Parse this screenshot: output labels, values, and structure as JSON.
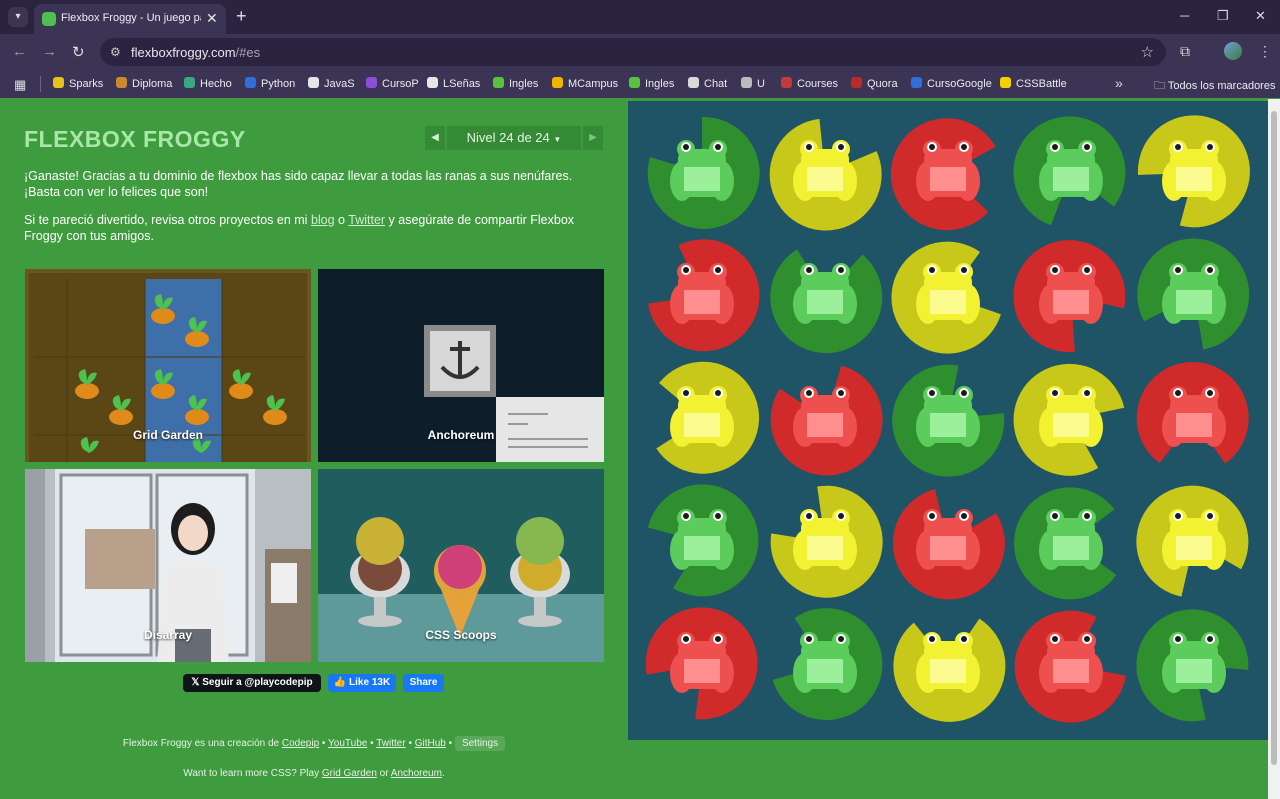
{
  "browser": {
    "tab_title": "Flexbox Froggy - Un juego para",
    "url_host": "flexboxfroggy.com",
    "url_path": "/#es",
    "bookmarks": [
      {
        "label": "Sparks",
        "color": "#e8c21a"
      },
      {
        "label": "Diploma",
        "color": "#c98a2d"
      },
      {
        "label": "Hecho",
        "color": "#39a884"
      },
      {
        "label": "Python",
        "color": "#2f6fd8"
      },
      {
        "label": "JavaS",
        "color": "#e6e6e6"
      },
      {
        "label": "CursoP",
        "color": "#8a4fd8"
      },
      {
        "label": "LSeñas",
        "color": "#e6e6e6"
      },
      {
        "label": "Ingles",
        "color": "#58c140"
      },
      {
        "label": "MCampus",
        "color": "#f0b400"
      },
      {
        "label": "Ingles",
        "color": "#58c140"
      },
      {
        "label": "Chat",
        "color": "#d9d9d9"
      },
      {
        "label": "U",
        "color": "#bbbbbb"
      },
      {
        "label": "Courses",
        "color": "#c23a3a"
      },
      {
        "label": "Quora",
        "color": "#b92b27"
      },
      {
        "label": "CursoGoogle",
        "color": "#2f6fd8"
      },
      {
        "label": "CSSBattle",
        "color": "#f5d000"
      }
    ],
    "all_bookmarks": "Todos los marcadores"
  },
  "game": {
    "logo": "FLEXBOX FROGGY",
    "level": "Nivel 24 de 24",
    "intro_1": "¡Ganaste! Gracias a tu dominio de flexbox has sido capaz llevar a todas las ranas a sus nenúfares. ¡Basta con ver lo felices que son!",
    "intro_2_before": "Si te pareció divertido, revisa otros proyectos en mi ",
    "link_blog": "blog",
    "intro_2_mid": " o ",
    "link_twitter": "Twitter",
    "intro_2_after": " y asegúrate de compartir Flexbox Froggy con tus amigos.",
    "projects": [
      {
        "label": "Grid Garden"
      },
      {
        "label": "Anchoreum"
      },
      {
        "label": "Disarray"
      },
      {
        "label": "CSS Scoops"
      }
    ],
    "social": {
      "twitter_follow": "Seguir a @playcodepip",
      "fb_like": "Like 13K",
      "fb_share": "Share"
    },
    "footer_line1": {
      "before": "Flexbox Froggy es una creación de ",
      "codepip": "Codepip",
      "youtube": "YouTube",
      "twitter": "Twitter",
      "github": "GitHub",
      "settings": "Settings",
      "sep": " • "
    },
    "footer_line2": {
      "before": "Want to learn more CSS? Play ",
      "grid_garden": "Grid Garden",
      "or": " or ",
      "anchoreum": "Anchoreum",
      "end": "."
    }
  },
  "board": {
    "colors": {
      "green": {
        "pad": "#2f8f2f",
        "frog": "#5ccc5c",
        "belly": "#9cf09c"
      },
      "yellow": {
        "pad": "#c8c81a",
        "frog": "#f2f233",
        "belly": "#fbfb8f"
      },
      "red": {
        "pad": "#d12a2a",
        "frog": "#ee4f4f",
        "belly": "#ff8f8f"
      }
    },
    "rows": [
      [
        "green",
        "yellow",
        "red",
        "green",
        "yellow"
      ],
      [
        "red",
        "green",
        "yellow",
        "red",
        "green"
      ],
      [
        "yellow",
        "red",
        "green",
        "yellow",
        "red"
      ],
      [
        "green",
        "yellow",
        "red",
        "green",
        "yellow"
      ],
      [
        "red",
        "green",
        "yellow",
        "red",
        "green"
      ]
    ]
  }
}
